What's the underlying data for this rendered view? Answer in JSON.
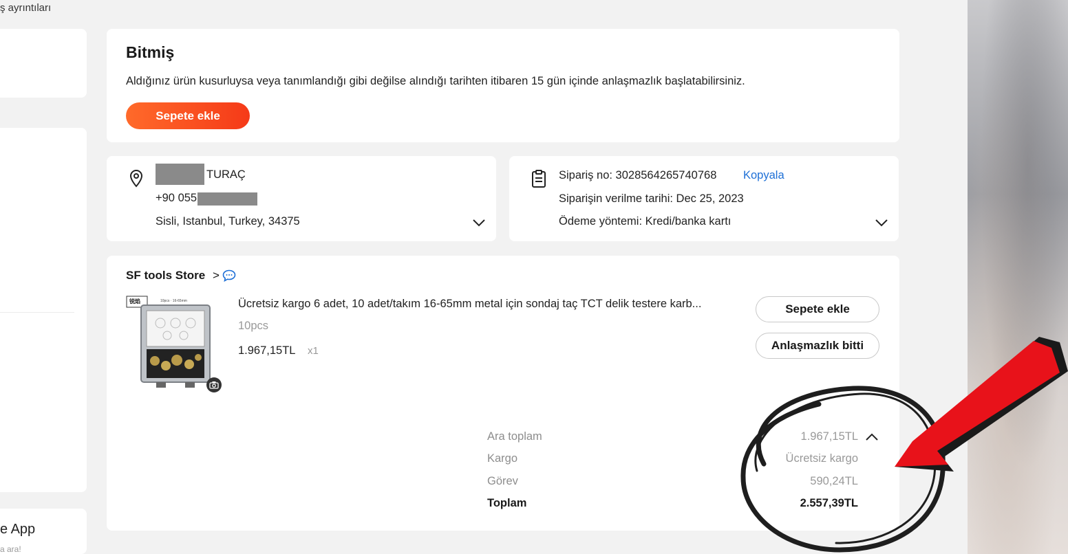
{
  "breadcrumb": {
    "text": "ş ayrıntıları"
  },
  "sidebar": {
    "app_label": "e App",
    "app_sub": "a ara!"
  },
  "status": {
    "title": "Bitmiş",
    "description": "Aldığınız ürün kusurluysa veya tanımlandığı gibi değilse alındığı tarihten itibaren 15 gün içinde anlaşmazlık başlatabilirsiniz.",
    "add_to_cart": "Sepete ekle"
  },
  "address": {
    "name_suffix": "TURAÇ",
    "phone_prefix": "+90 055",
    "location": "Sisli, Istanbul, Turkey, 34375"
  },
  "order": {
    "number_label": "Sipariş no: 3028564265740768",
    "copy_label": "Kopyala",
    "date_label": "Siparişin verilme tarihi: Dec 25, 2023",
    "payment_label": "Ödeme yöntemi: Kredi/banka kartı"
  },
  "store": {
    "name": "SF tools Store",
    "chevron": ">"
  },
  "product": {
    "title": "Ücretsiz kargo 6 adet, 10 adet/takım 16-65mm metal için sondaj taç TCT delik testere karb...",
    "variant": "10pcs",
    "price": "1.967,15TL",
    "quantity": "x1",
    "image_brand": "锐焰",
    "image_caption": "10pcs · 16-65mm",
    "add_to_cart": "Sepete ekle",
    "dispute_done": "Anlaşmazlık bitti"
  },
  "totals": {
    "subtotal_label": "Ara toplam",
    "subtotal_value": "1.967,15TL",
    "shipping_label": "Kargo",
    "shipping_value": "Ücretsiz kargo",
    "duty_label": "Görev",
    "duty_value": "590,24TL",
    "total_label": "Toplam",
    "total_value": "2.557,39TL"
  },
  "colors": {
    "accent_orange": "#f5501f",
    "link_blue": "#1d6fd6",
    "annotation_red": "#e8121a"
  },
  "icons": [
    "location-pin-icon",
    "clipboard-icon",
    "chevron-down-icon",
    "chat-bubble-icon",
    "chevron-right-icon",
    "chevron-up-icon",
    "camera-icon"
  ]
}
